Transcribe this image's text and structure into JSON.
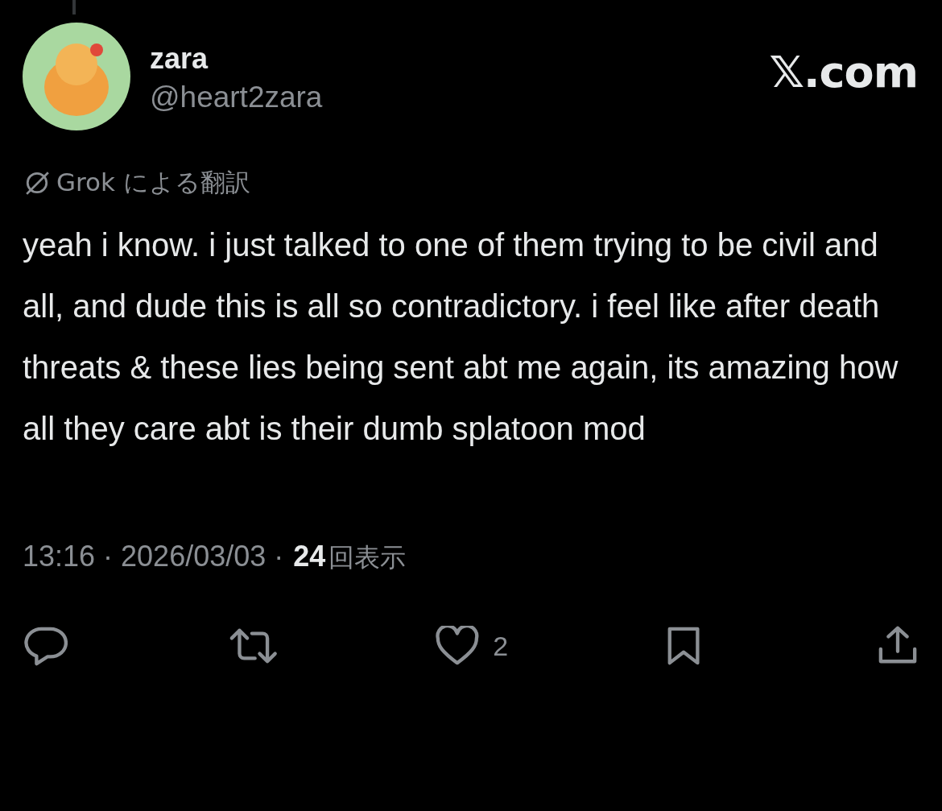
{
  "post": {
    "author": {
      "name": "zara",
      "handle": "@heart2zara"
    },
    "source": "𝕏.com",
    "translation_label": "Grok による翻訳",
    "text": "yeah i know. i just talked to one of them trying to be civil and all, and dude this is all so contradictory. i feel like after death threats & these lies being sent abt me again, its amazing how all they care abt is their dumb splatoon mod",
    "time": "13:16 · 2026/03/03 ·",
    "views_count": "24",
    "views_label": "回表示",
    "actions": [
      {
        "kind": "reply"
      },
      {
        "kind": "repost"
      },
      {
        "kind": "like",
        "count": "2"
      },
      {
        "kind": "bookmark"
      },
      {
        "kind": "share"
      }
    ]
  }
}
